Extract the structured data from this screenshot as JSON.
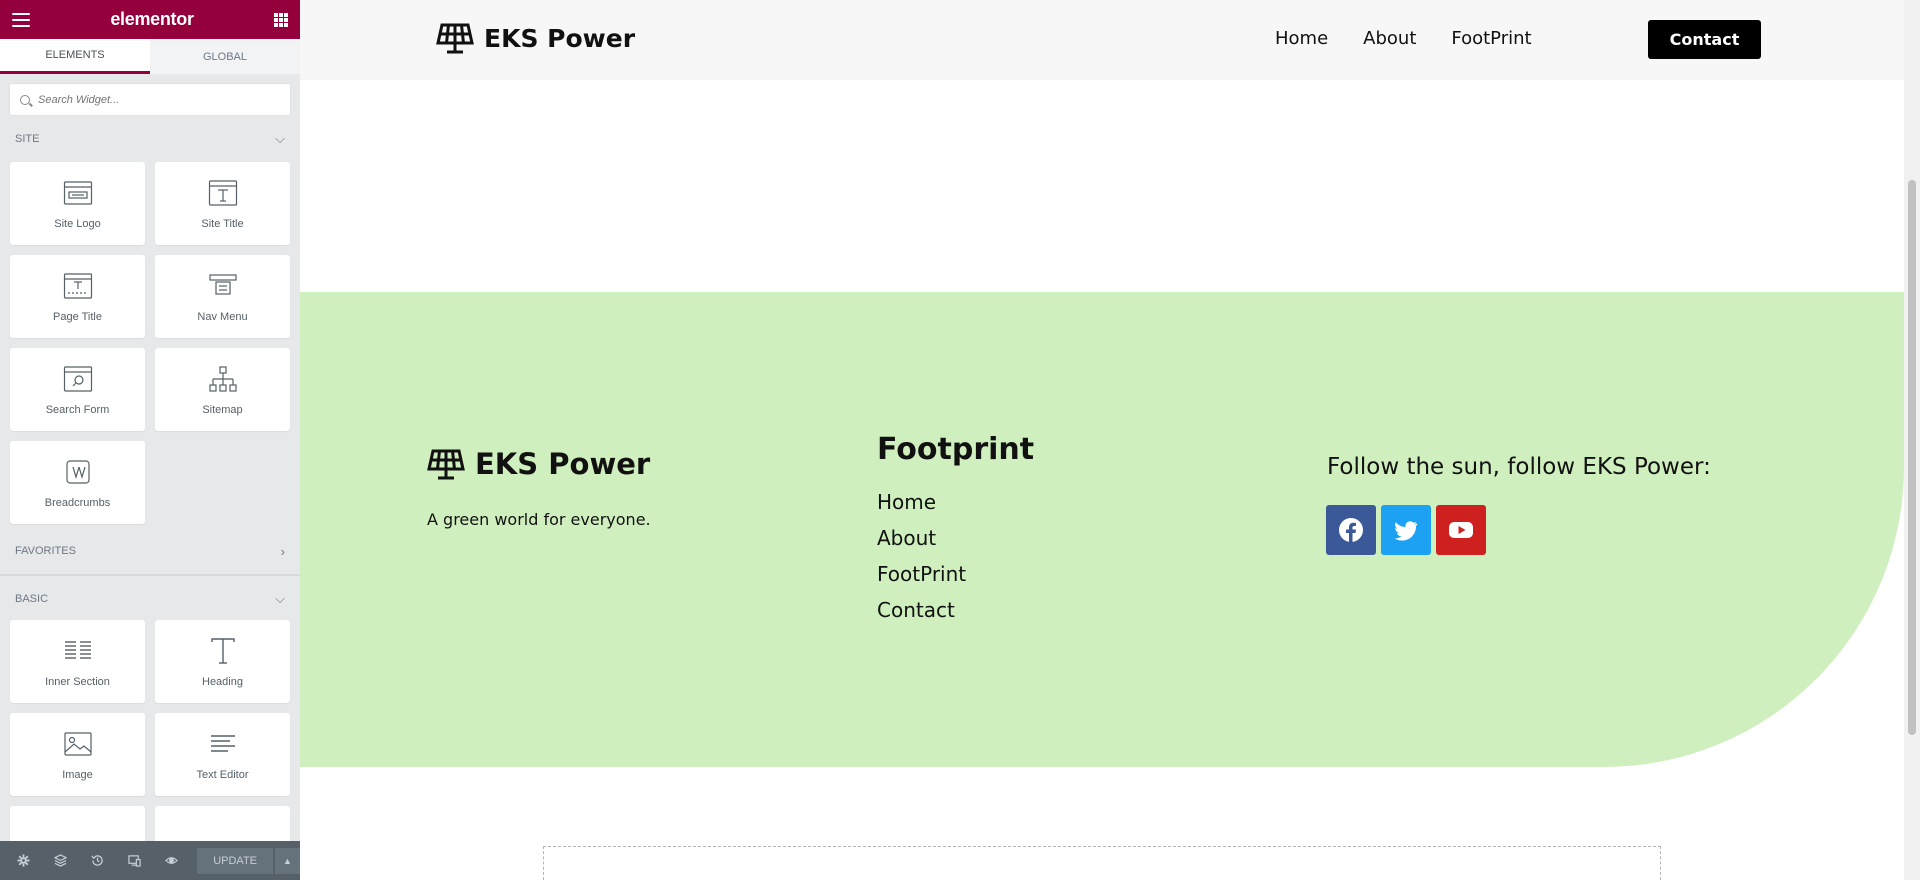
{
  "editor": {
    "brand": "elementor",
    "tabs": [
      {
        "label": "ELEMENTS",
        "active": true
      },
      {
        "label": "GLOBAL",
        "active": false
      }
    ],
    "search": {
      "placeholder": "Search Widget..."
    },
    "categories": {
      "site": {
        "label": "SITE",
        "widgets": [
          {
            "label": "Site Logo",
            "icon": "site-logo-icon"
          },
          {
            "label": "Site Title",
            "icon": "site-title-icon"
          },
          {
            "label": "Page Title",
            "icon": "page-title-icon"
          },
          {
            "label": "Nav Menu",
            "icon": "nav-menu-icon"
          },
          {
            "label": "Search Form",
            "icon": "search-form-icon"
          },
          {
            "label": "Sitemap",
            "icon": "sitemap-icon"
          },
          {
            "label": "Breadcrumbs",
            "icon": "breadcrumbs-icon"
          }
        ]
      },
      "favorites": {
        "label": "FAVORITES"
      },
      "basic": {
        "label": "BASIC",
        "widgets": [
          {
            "label": "Inner Section",
            "icon": "inner-section-icon"
          },
          {
            "label": "Heading",
            "icon": "heading-icon"
          },
          {
            "label": "Image",
            "icon": "image-icon"
          },
          {
            "label": "Text Editor",
            "icon": "text-editor-icon"
          }
        ]
      }
    },
    "footer": {
      "update_label": "UPDATE",
      "icons": [
        "settings-icon",
        "layers-icon",
        "history-icon",
        "responsive-icon",
        "preview-eye-icon"
      ]
    },
    "colors": {
      "brand": "#93003c",
      "panel_bg": "#e6e8ea",
      "footer_bg": "#556068"
    }
  },
  "site": {
    "header": {
      "brand": "EKS Power",
      "nav": [
        "Home",
        "About",
        "FootPrint"
      ],
      "cta": "Contact"
    },
    "footer": {
      "brand": "EKS Power",
      "tagline": "A green world for everyone.",
      "footprint_title": "Footprint",
      "footprint_links": [
        "Home",
        "About",
        "FootPrint",
        "Contact"
      ],
      "follow_text": "Follow the sun, follow EKS Power:",
      "socials": [
        {
          "name": "facebook-icon",
          "color": "#3b5998"
        },
        {
          "name": "twitter-icon",
          "color": "#1da1f2"
        },
        {
          "name": "youtube-icon",
          "color": "#cd201f"
        }
      ],
      "bg_color": "#d0efbe"
    }
  }
}
